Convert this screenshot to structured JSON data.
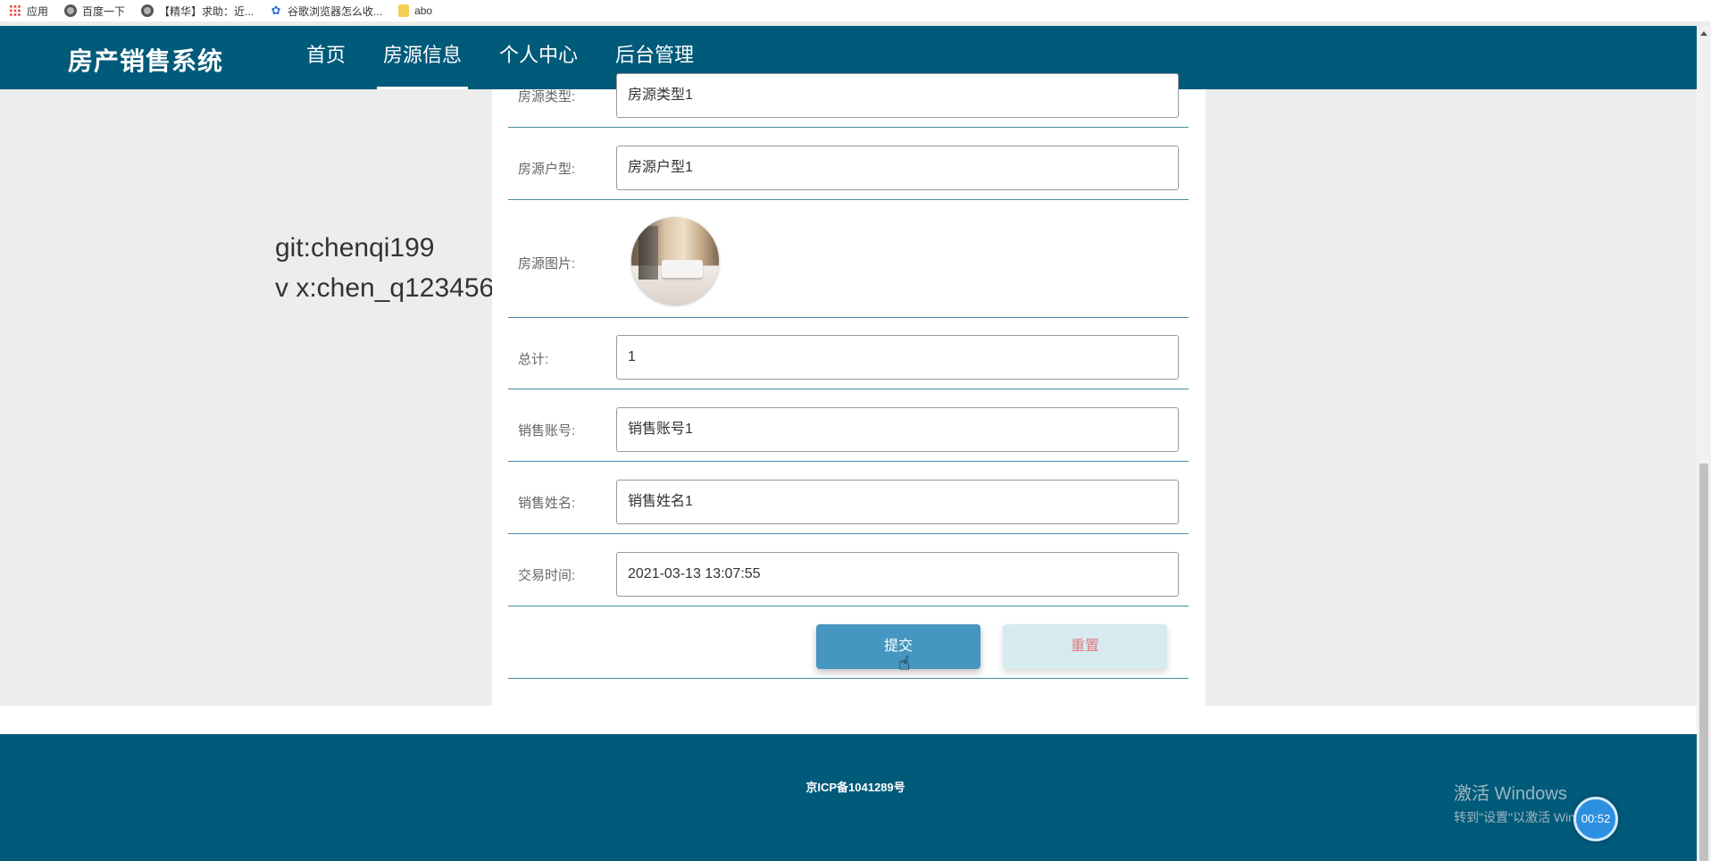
{
  "bookmarks": [
    {
      "label": "应用",
      "icon": "apps-icon"
    },
    {
      "label": "百度一下",
      "icon": "globe-icon"
    },
    {
      "label": "【精华】求助：近...",
      "icon": "globe-icon"
    },
    {
      "label": "谷歌浏览器怎么收...",
      "icon": "paw-icon"
    },
    {
      "label": "abo",
      "icon": "folder-icon"
    }
  ],
  "header": {
    "brand": "房产销售系统",
    "nav": [
      {
        "label": "首页"
      },
      {
        "label": "房源信息",
        "active": true
      },
      {
        "label": "个人中心"
      },
      {
        "label": "后台管理"
      }
    ]
  },
  "watermark": {
    "line1": "git:chenqi199",
    "line2": "v x:chen_q123456"
  },
  "form": {
    "type_label": "房源类型:",
    "type_value": "房源类型1",
    "layout_label": "房源户型:",
    "layout_value": "房源户型1",
    "image_label": "房源图片:",
    "total_label": "总计:",
    "total_value": "1",
    "account_label": "销售账号:",
    "account_value": "销售账号1",
    "name_label": "销售姓名:",
    "name_value": "销售姓名1",
    "time_label": "交易时间:",
    "time_value": "2021-03-13 13:07:55",
    "submit_label": "提交",
    "reset_label": "重置"
  },
  "footer": {
    "icp": "京ICP备1041289号",
    "activate_title": "激活 Windows",
    "activate_sub": "转到\"设置\"以激活 Windows。"
  },
  "timer": "00:52",
  "colors": {
    "header_bg": "#005a7a",
    "submit_bg": "#4596c0",
    "reset_bg": "#d6ebf0",
    "reset_text": "#e07a80"
  }
}
